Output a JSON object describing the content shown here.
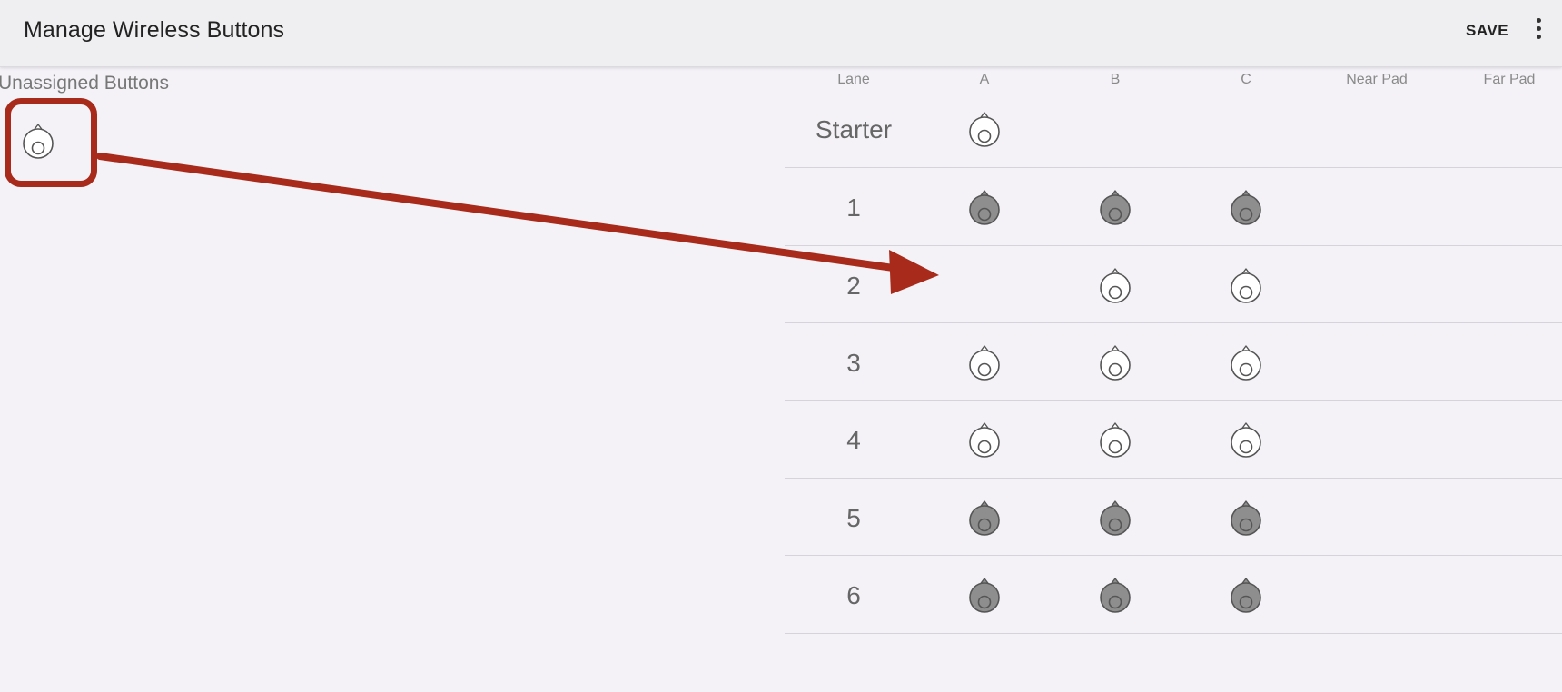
{
  "appbar": {
    "title": "Manage Wireless Buttons",
    "save_label": "SAVE",
    "more_icon": "more-vert-icon"
  },
  "unassigned": {
    "label": "Unassigned Buttons",
    "buttons": [
      {
        "state": "unassigned"
      }
    ]
  },
  "table": {
    "columns": [
      "Lane",
      "A",
      "B",
      "C",
      "Near Pad",
      "Far Pad"
    ],
    "rows": [
      {
        "lane": "Starter",
        "cells": [
          "white",
          "none",
          "none",
          "none",
          "none"
        ]
      },
      {
        "lane": "1",
        "cells": [
          "gray",
          "gray",
          "gray",
          "none",
          "none"
        ]
      },
      {
        "lane": "2",
        "cells": [
          "none",
          "white",
          "white",
          "none",
          "none"
        ]
      },
      {
        "lane": "3",
        "cells": [
          "white",
          "white",
          "white",
          "none",
          "none"
        ]
      },
      {
        "lane": "4",
        "cells": [
          "white",
          "white",
          "white",
          "none",
          "none"
        ]
      },
      {
        "lane": "5",
        "cells": [
          "gray",
          "gray",
          "gray",
          "none",
          "none"
        ]
      },
      {
        "lane": "6",
        "cells": [
          "gray",
          "gray",
          "gray",
          "none",
          "none"
        ]
      }
    ]
  },
  "colors": {
    "annotation": "#a72a1a",
    "button_gray": "#8e8e8e",
    "button_white": "#ffffff"
  }
}
